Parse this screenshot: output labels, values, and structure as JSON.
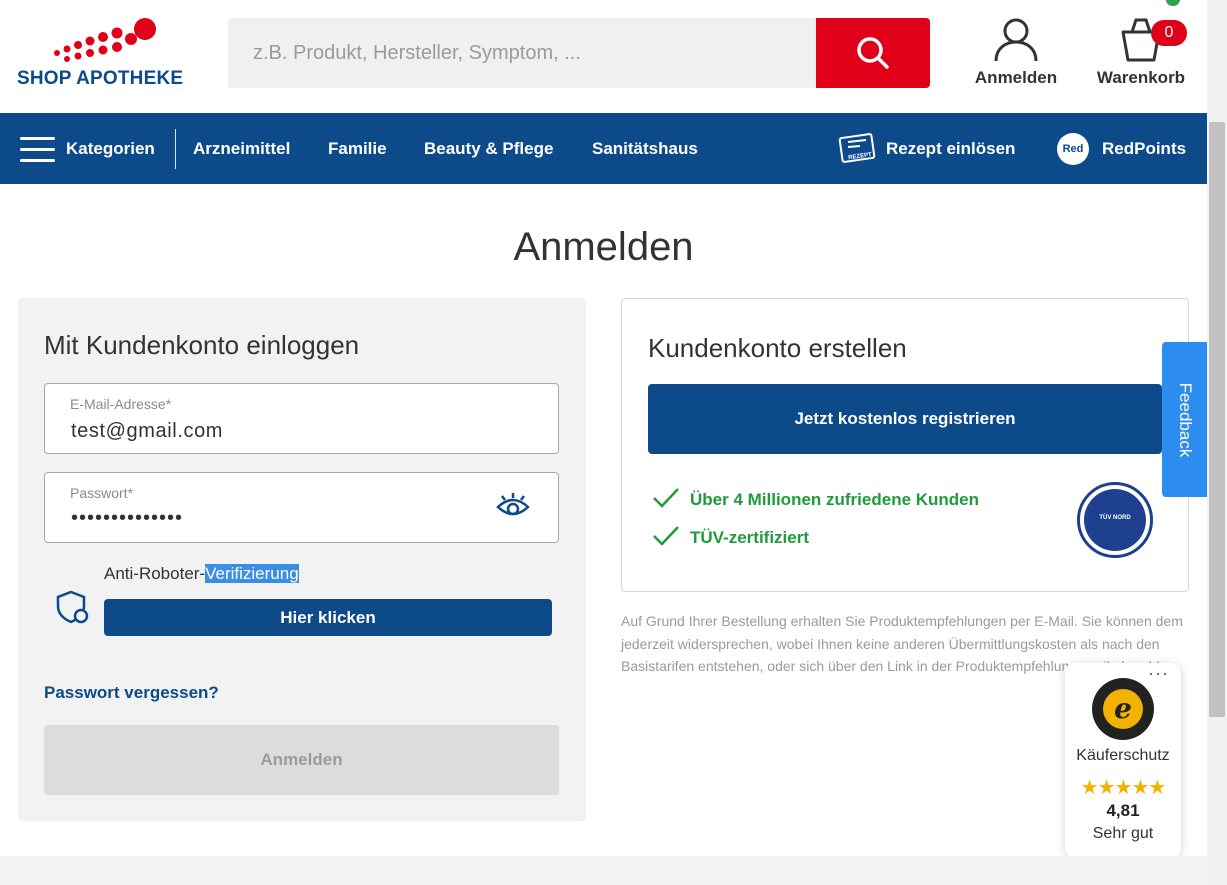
{
  "brand": {
    "name": "SHOP APOTHEKE",
    "primary_color": "#0d4a8a",
    "accent_color": "#e0001a"
  },
  "search": {
    "placeholder": "z.B. Produkt, Hersteller, Symptom, ...",
    "button_icon": "search-icon"
  },
  "header": {
    "login_label": "Anmelden",
    "cart_label": "Warenkorb",
    "cart_count": "0"
  },
  "nav": {
    "menu_label": "Kategorien",
    "items": [
      "Arzneimittel",
      "Familie",
      "Beauty & Pflege",
      "Sanitätshaus"
    ],
    "prescription_label": "Rezept einlösen",
    "prescription_icon_text": "REZEPT",
    "redpoints_badge": "Red",
    "redpoints_label": "RedPoints"
  },
  "page": {
    "title": "Anmelden"
  },
  "login": {
    "heading": "Mit Kundenkonto einloggen",
    "email_label": "E-Mail-Adresse*",
    "email_value": "test@gmail.com",
    "password_label": "Passwort*",
    "password_value": "••••••••••••••",
    "captcha_prefix": "Anti-Roboter-",
    "captcha_highlight": "Verifizierung",
    "captcha_button": "Hier klicken",
    "forgot_link": "Passwort vergessen?",
    "submit_label": "Anmelden"
  },
  "register": {
    "heading": "Kundenkonto erstellen",
    "button": "Jetzt kostenlos registrieren",
    "checks": [
      "Über 4 Millionen zufriedene Kunden",
      "TÜV-zertifiziert"
    ],
    "seal_text": "TÜV NORD"
  },
  "disclaimer": "Auf Grund Ihrer Bestellung erhalten Sie Produktempfehlungen per E-Mail. Sie können dem jederzeit widersprechen, wobei Ihnen keine anderen Übermittlungskosten als nach den Basistarifen entstehen, oder sich über den Link in der Produktempfehlungsmail abmelden.",
  "feedback": {
    "label": "Feedback"
  },
  "trusted_shops": {
    "menu_dots": "···",
    "seal_letter": "e",
    "label": "Käuferschutz",
    "stars": "★★★★★",
    "score": "4,81",
    "verdict": "Sehr gut"
  }
}
